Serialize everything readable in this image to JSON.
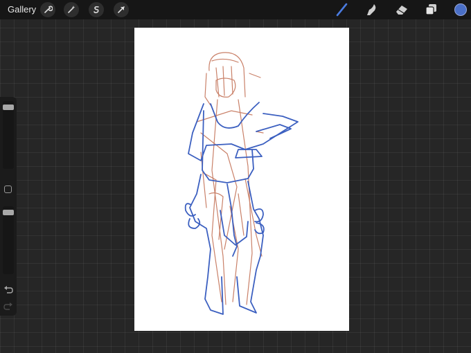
{
  "toolbar": {
    "gallery_label": "Gallery",
    "left_icons": [
      "wrench-icon",
      "magic-wand-icon",
      "selection-icon",
      "transform-arrow-icon"
    ],
    "right_tools": [
      "brush-icon",
      "smudge-icon",
      "eraser-icon",
      "layers-icon"
    ],
    "active_tool": "brush-icon",
    "current_color": "#4a6fc7"
  },
  "sidebar": {
    "brush_size_level": 0.05,
    "opacity_level": 0.05
  },
  "sketch_colors": {
    "construction": "#c98068",
    "linework": "#3b5fc0"
  }
}
